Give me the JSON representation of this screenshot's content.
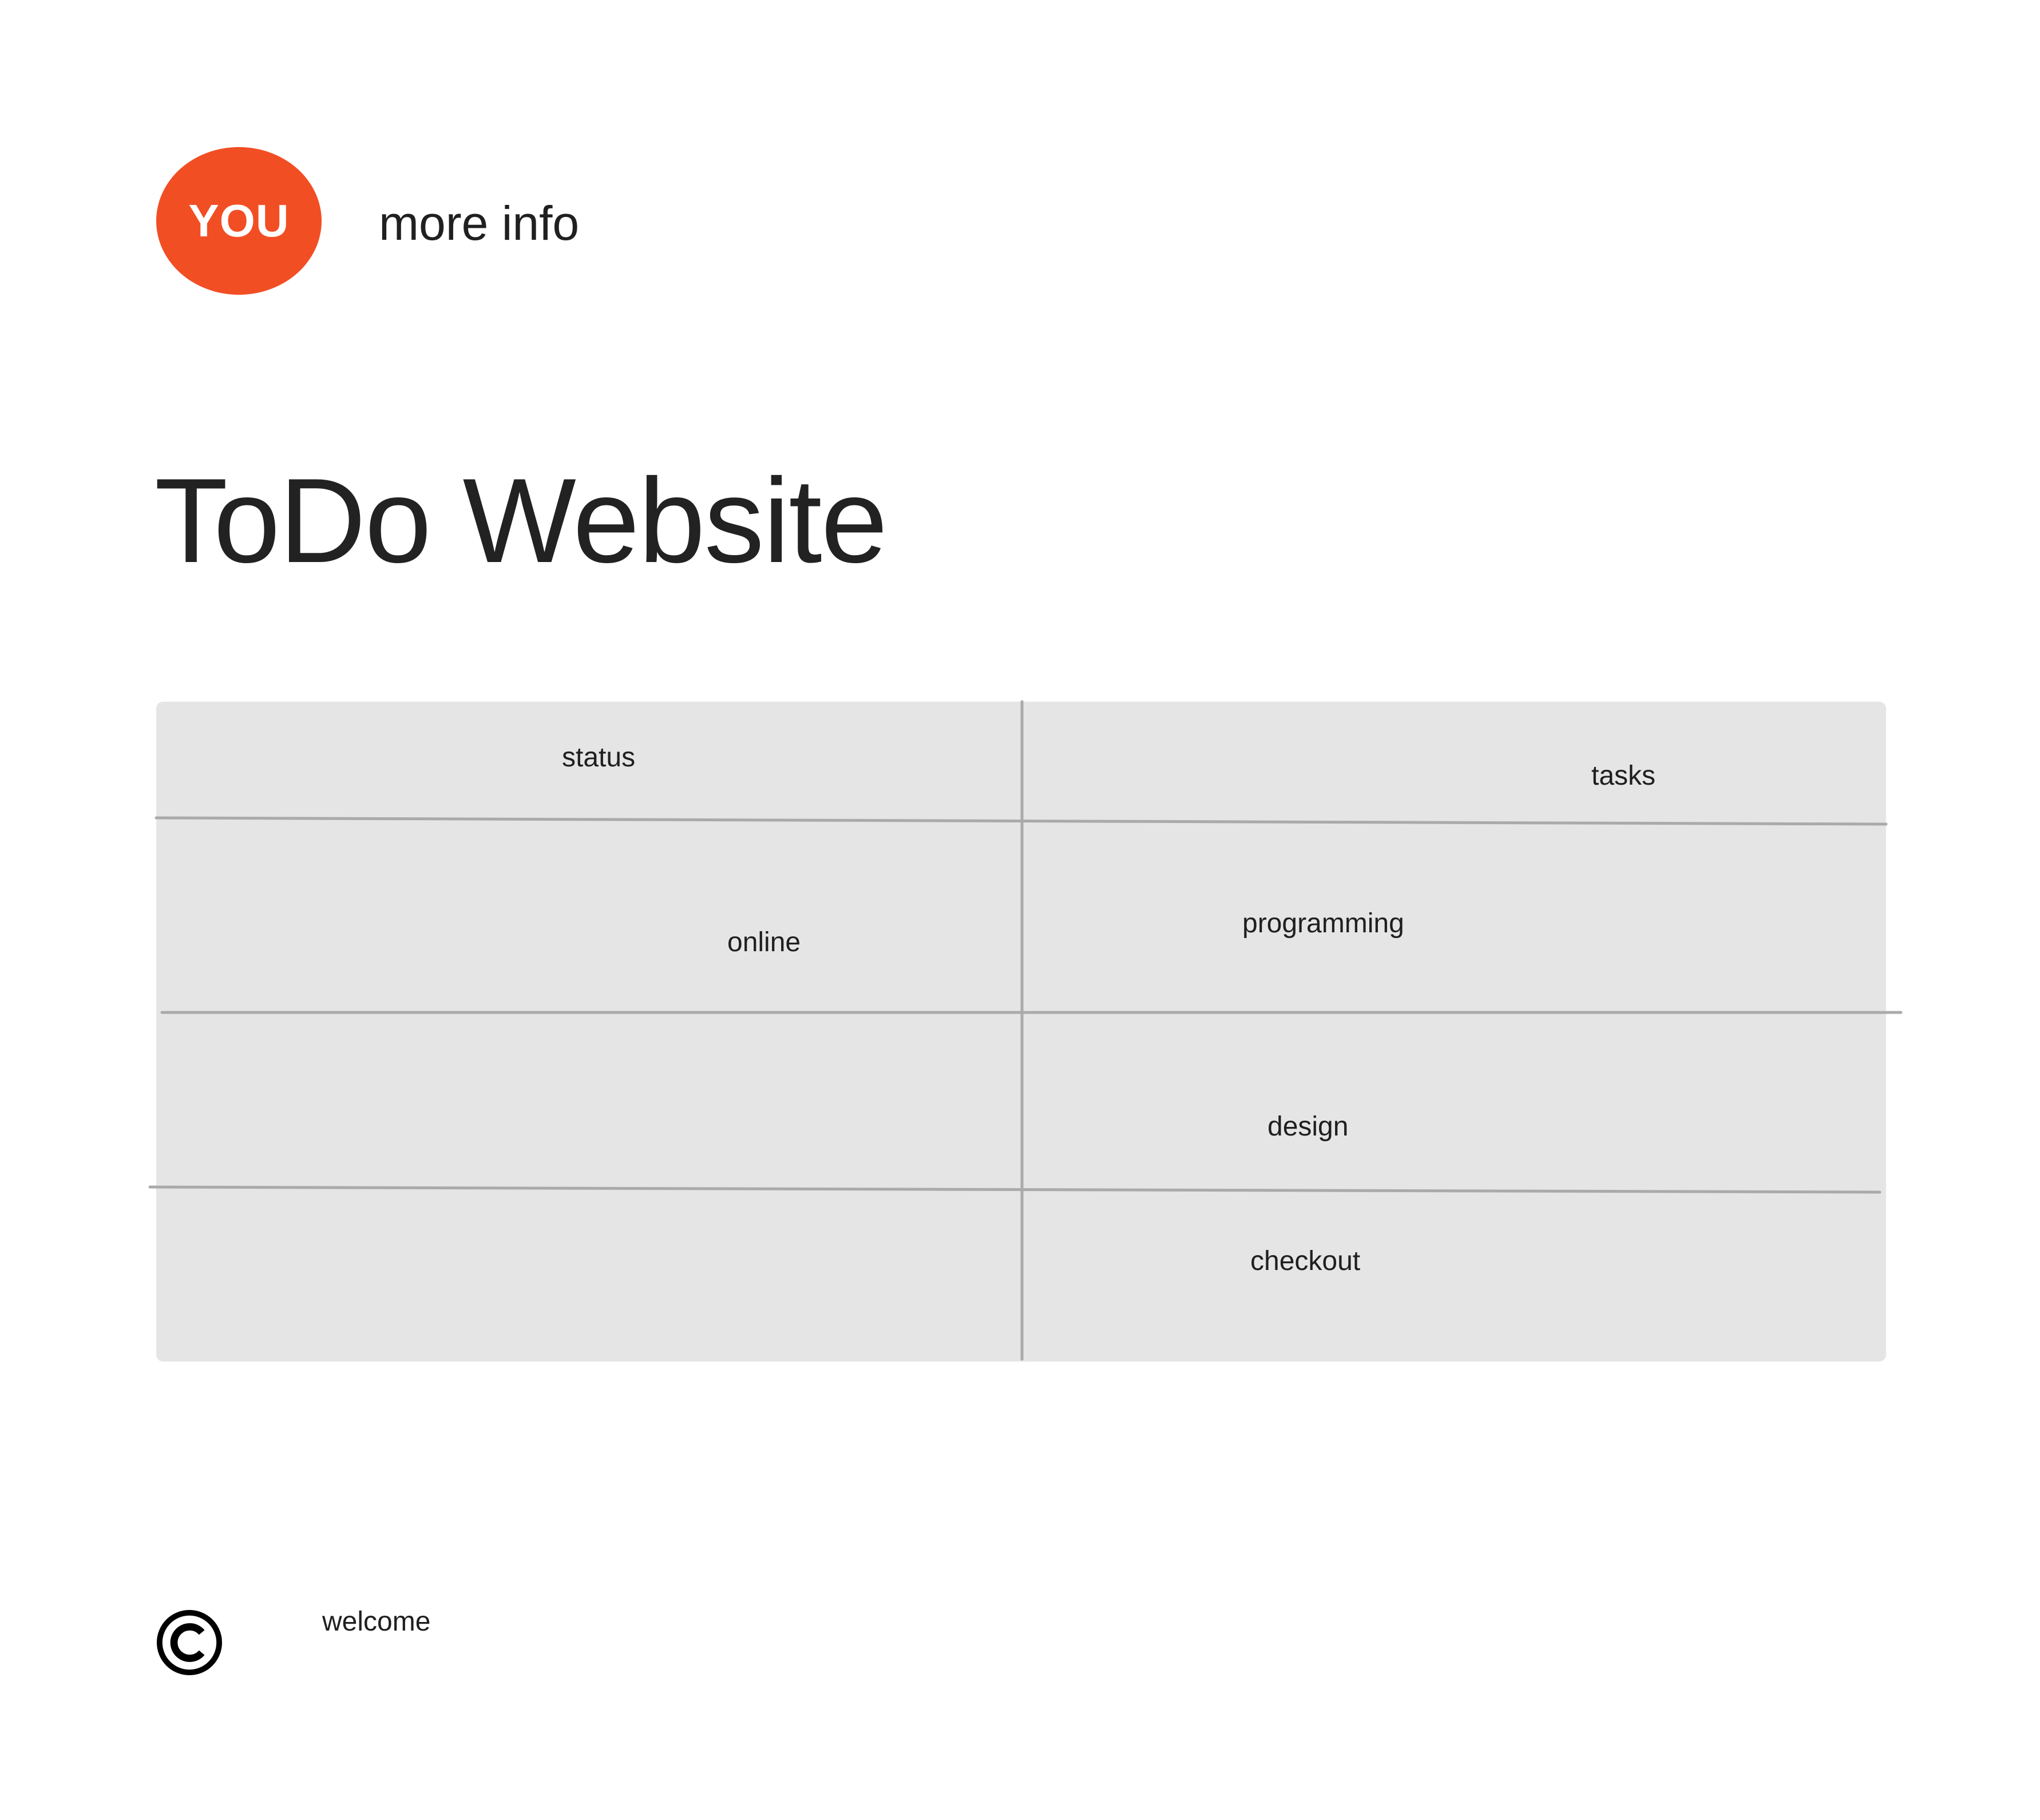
{
  "header": {
    "avatar_label": "YOU",
    "more_info_link": "more info"
  },
  "page": {
    "title": "ToDo Website"
  },
  "table": {
    "headers": {
      "status": "status",
      "tasks": "tasks"
    },
    "rows": [
      {
        "status": "online",
        "task": "programming"
      },
      {
        "status": "",
        "task": "design"
      },
      {
        "status": "",
        "task": "checkout"
      }
    ]
  },
  "footer": {
    "icon": "copyright-icon",
    "text": "welcome"
  },
  "colors": {
    "avatar_background": "#f24e24",
    "table_background": "#e5e5e5",
    "grid_line": "#aaaaaa"
  }
}
